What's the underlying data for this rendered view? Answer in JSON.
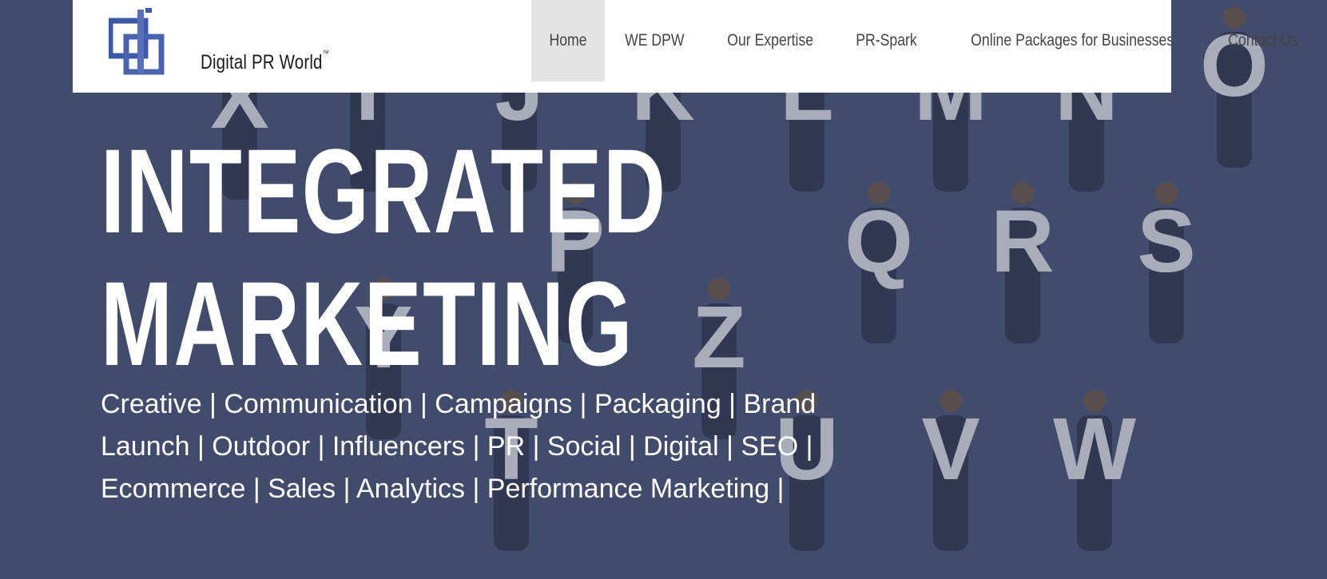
{
  "brand": {
    "name": "Digital PR World",
    "trademark": "™"
  },
  "nav": {
    "items": [
      {
        "label": "Home",
        "active": true
      },
      {
        "label": "WE DPW",
        "active": false
      },
      {
        "label": "Our Expertise",
        "active": false
      },
      {
        "label": "PR-Spark",
        "active": false
      },
      {
        "label": "Online Packages for Businesses",
        "active": false
      },
      {
        "label": "Contact Us",
        "active": false
      }
    ]
  },
  "hero": {
    "headline_line1": "INTEGRATED",
    "headline_line2": "MARKETING",
    "tagline": "Creative | Communication | Campaigns | Packaging | Brand Launch | Outdoor | Influencers | PR | Social | Digital | SEO | Ecommerce | Sales | Analytics | Performance Marketing |",
    "background_letters": [
      "I",
      "J",
      "K",
      "L",
      "M",
      "N",
      "O",
      "P",
      "Q",
      "R",
      "S",
      "T",
      "U",
      "V",
      "W",
      "X",
      "Y",
      "Z"
    ]
  },
  "colors": {
    "hero_bg": "#414b6b",
    "header_bg": "#ffffff",
    "active_nav_bg": "#e4e4e4",
    "logo_blue": "#3d5aa8"
  }
}
